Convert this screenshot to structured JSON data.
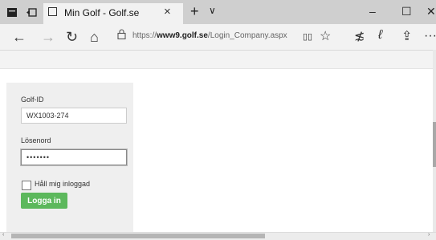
{
  "browser": {
    "tab": {
      "title": "Min Golf - Golf.se",
      "close": "×"
    },
    "new_tab": "+",
    "tab_menu": "∨",
    "window": {
      "minimize": "–",
      "maximize": "☐",
      "close": "✕"
    },
    "nav": {
      "back": "←",
      "forward": "→",
      "refresh": "↻",
      "home": "⌂"
    },
    "url": {
      "prefix": "https://",
      "domain": "www9.golf.se",
      "path": "/Login_Company.aspx"
    },
    "toolbar": {
      "reading_view": "▯▯",
      "favorite": "☆",
      "hub": "≴",
      "notes": "ℓ",
      "share": "⇪",
      "more": "···"
    }
  },
  "login": {
    "golf_id_label": "Golf-ID",
    "golf_id_value": "WX1003-274",
    "password_label": "Lösenord",
    "password_value": "•••••••",
    "remember_label": "Håll mig inloggad",
    "remember_checked": false,
    "submit_label": "Logga in",
    "submit_color": "#5cb85c"
  },
  "scrollbar": {
    "left_arrow": "‹",
    "right_arrow": "›"
  }
}
